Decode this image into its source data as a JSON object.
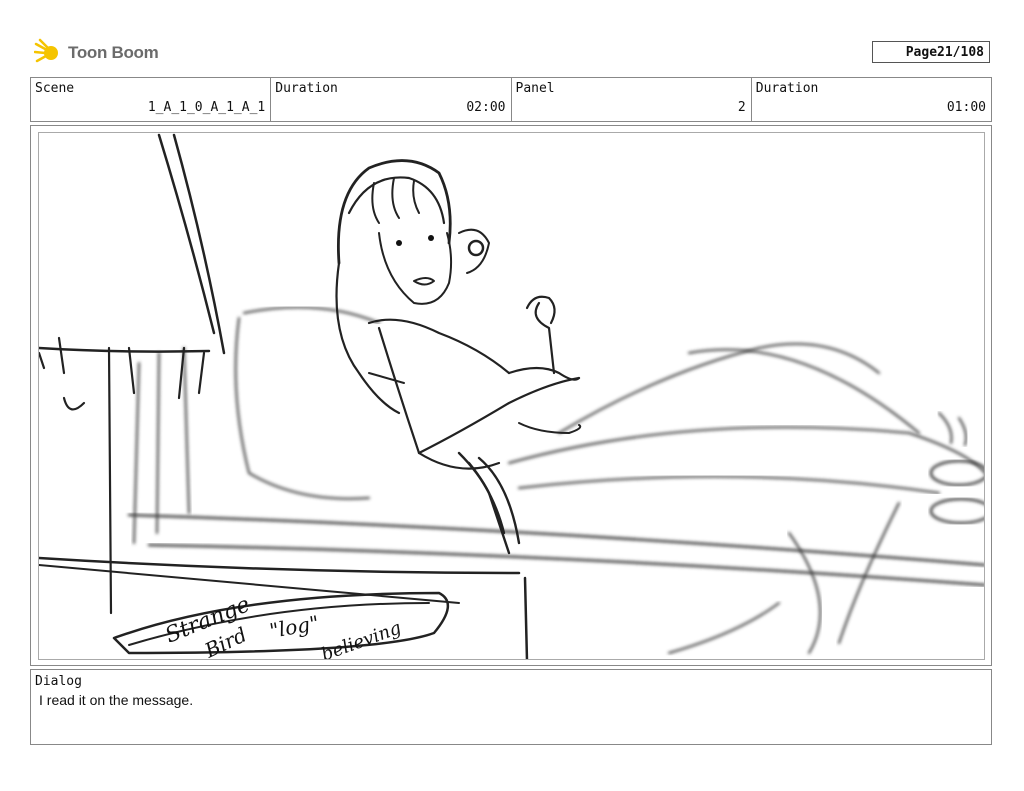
{
  "brand": {
    "name": "Toon Boom",
    "icon": "toon-boom-logo-icon",
    "accent": "#f5c400"
  },
  "page": {
    "label": "Page",
    "value": "21/108"
  },
  "header": {
    "scene_label": "Scene",
    "scene_value": "1_A_1_0_A_1_A_1",
    "duration_label": "Duration",
    "duration_value": "02:00",
    "panel_label": "Panel",
    "panel_value": "2",
    "panel_duration_label": "Duration",
    "panel_duration_value": "01:00"
  },
  "sketch": {
    "note_line1": "Strange",
    "note_line2": "Bird",
    "note_line3": "\"log\"",
    "note_line4": "believing"
  },
  "dialog": {
    "label": "Dialog",
    "text": "I read it on the message."
  }
}
